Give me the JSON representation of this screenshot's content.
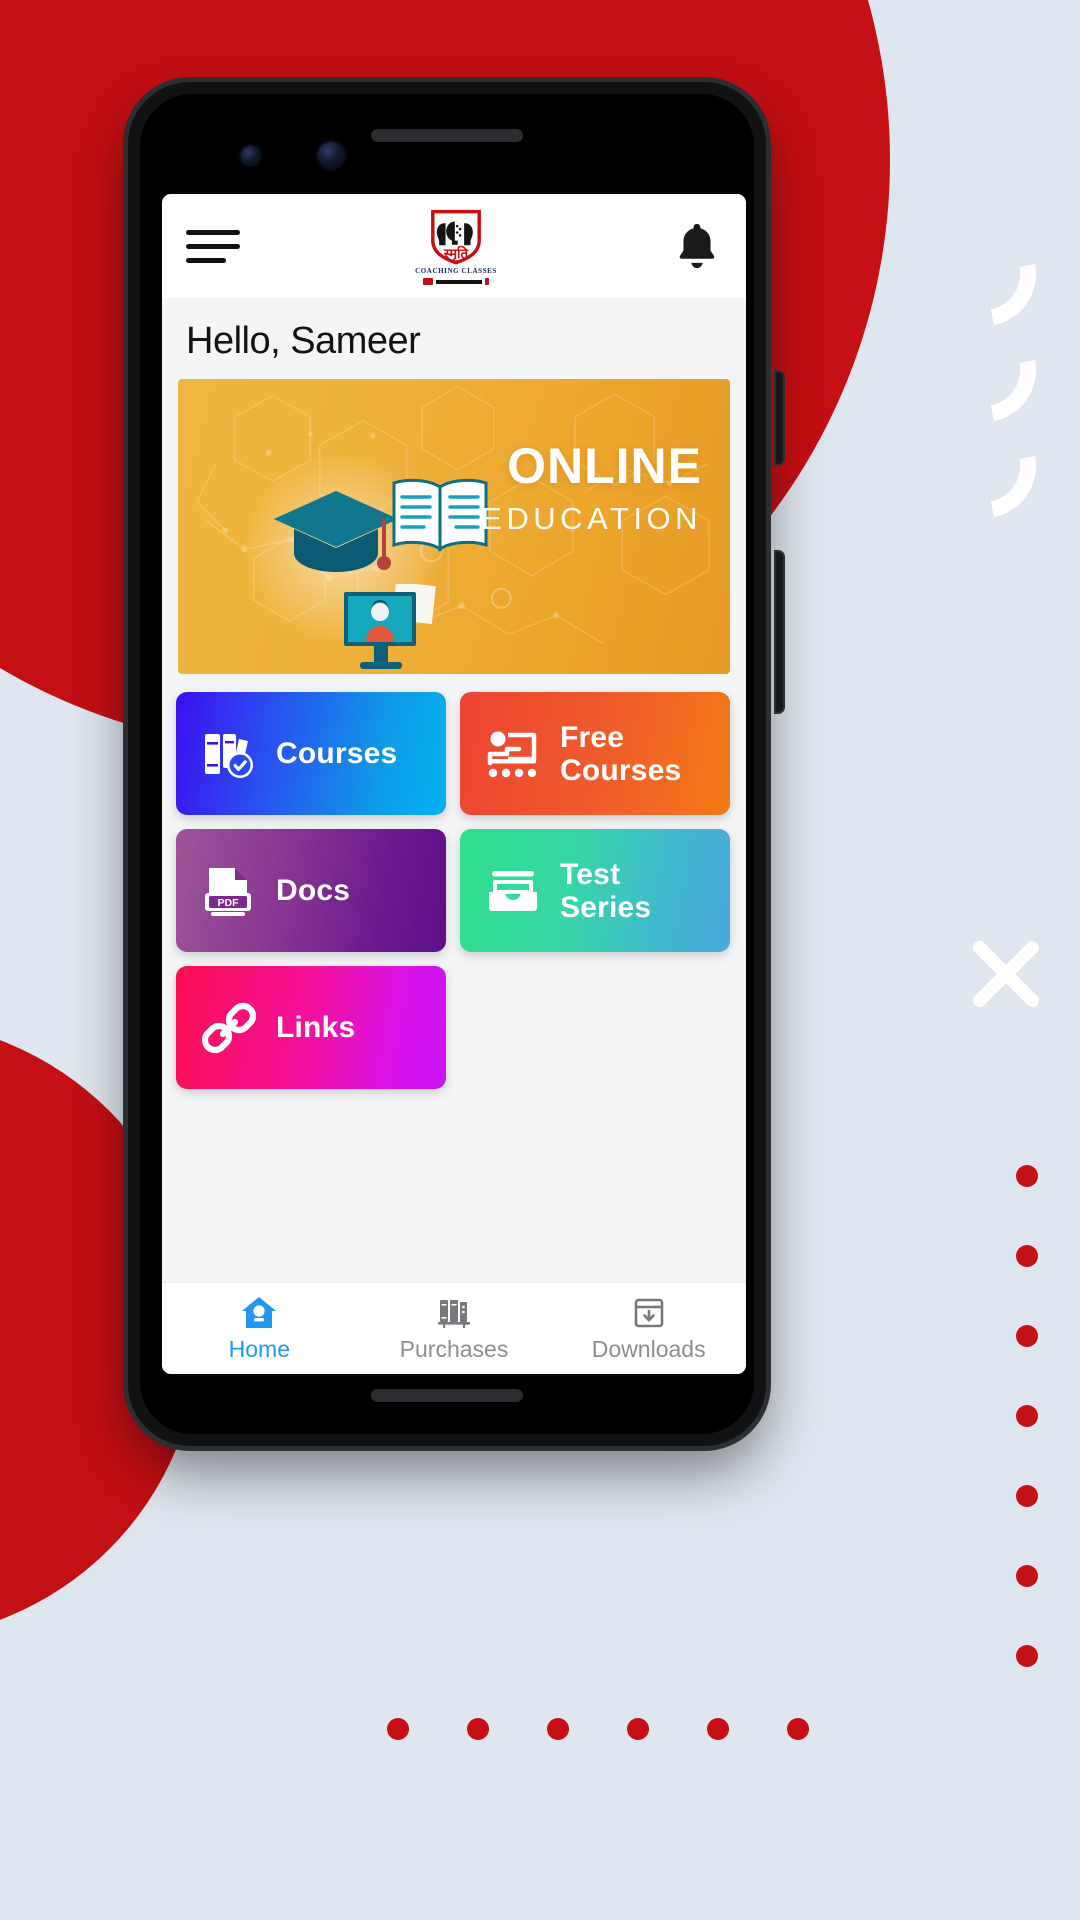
{
  "app": {
    "brand_name": "स्मृति",
    "brand_subtitle": "COACHING CLASSES",
    "greeting": "Hello, Sameer"
  },
  "header": {
    "menu_icon": "hamburger-menu-icon",
    "logo_icon": "smriti-coaching-classes-logo",
    "notification_icon": "bell-icon"
  },
  "banner": {
    "title": "ONLINE",
    "subtitle": "EDUCATION",
    "illustration": "graduation-cap-book-monitor-hexagon-network",
    "background_color": "#eeae33"
  },
  "tiles": [
    {
      "label": "Courses",
      "icon": "books-check-icon",
      "color_from": "#3c10ef",
      "color_to": "#04b2f0"
    },
    {
      "label": "Free\nCourses",
      "icon": "online-class-icon",
      "color_from": "#ec4331",
      "color_to": "#f47a16"
    },
    {
      "label": "Docs",
      "icon": "pdf-file-icon",
      "color_from": "#9b5597",
      "color_to": "#5d0f88"
    },
    {
      "label": "Test\nSeries",
      "icon": "inbox-archive-icon",
      "color_from": "#2fe08a",
      "color_to": "#4aa9de"
    },
    {
      "label": "Links",
      "icon": "chain-link-icon",
      "color_from": "#fa0f52",
      "color_to": "#c914f5"
    }
  ],
  "tile_labels": {
    "courses": "Courses",
    "free_line1": "Free",
    "free_line2": "Courses",
    "docs": "Docs",
    "test_line1": "Test",
    "test_line2": "Series",
    "links": "Links"
  },
  "bottom_nav": {
    "active": "Home",
    "active_color": "#2196f3",
    "inactive_color": "#8b8e92",
    "items": [
      {
        "label": "Home",
        "icon": "home-icon"
      },
      {
        "label": "Purchases",
        "icon": "books-shelf-icon"
      },
      {
        "label": "Downloads",
        "icon": "download-box-icon"
      }
    ]
  },
  "decoration": {
    "accent_color": "#c40f13",
    "page_background": "#dfe6ef"
  }
}
